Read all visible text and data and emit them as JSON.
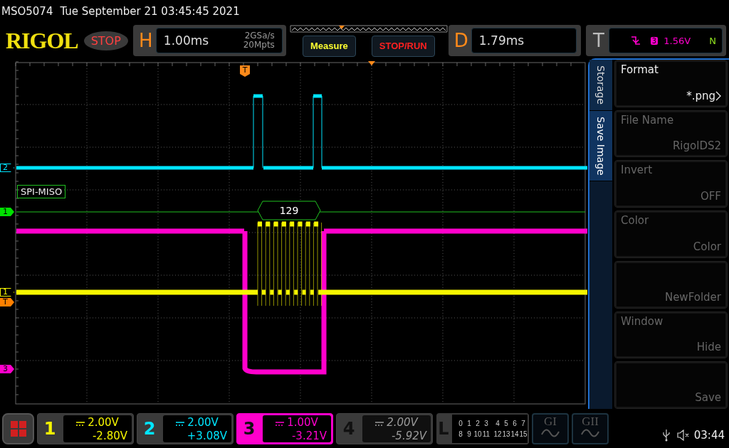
{
  "header": {
    "model": "MSO5074",
    "datetime": "Tue September 21 03:45:45 2021"
  },
  "topbar": {
    "logo": "RIGOL",
    "run_state": "STOP",
    "horizontal": {
      "letter": "H",
      "timebase": "1.00ms",
      "sample_rate": "2GSa/s",
      "memory_depth": "20Mpts"
    },
    "buttons": [
      {
        "label": "Measure",
        "kind": "measure"
      },
      {
        "label": "STOP/RUN",
        "kind": "run"
      }
    ],
    "delay": {
      "letter": "D",
      "value": "1.79ms"
    },
    "trigger": {
      "letter": "T",
      "source": "3",
      "level": "1.56V",
      "sweep": "N"
    }
  },
  "display": {
    "trigger_position_marker": "T",
    "markers": [
      {
        "label": "2",
        "color": "#00e5ff",
        "filled": false
      },
      {
        "label": "1",
        "color": "#00e000",
        "filled": true
      },
      {
        "label": "1",
        "color": "#f5f500",
        "filled": false
      },
      {
        "label": "T",
        "color": "#ff8000",
        "filled": true
      },
      {
        "label": "3",
        "color": "#ff00cc",
        "filled": true
      }
    ],
    "decode": {
      "label": "SPI-MISO",
      "value": "129"
    }
  },
  "side_menu": {
    "tabs": [
      {
        "label": "Storage",
        "selected": false
      },
      {
        "label": "Save Image",
        "selected": true
      }
    ],
    "items": [
      {
        "title": "Format",
        "value": "*.png",
        "submenu": true,
        "disabled": false
      },
      {
        "title": "File Name",
        "value": "RigolDS2",
        "submenu": false,
        "disabled": true
      },
      {
        "title": "Invert",
        "value": "OFF",
        "submenu": false,
        "disabled": true
      },
      {
        "title": "Color",
        "value": "Color",
        "submenu": false,
        "disabled": true
      },
      {
        "value": "NewFolder",
        "submenu": false,
        "disabled": true
      },
      {
        "title": "Window",
        "value": "Hide",
        "submenu": false,
        "disabled": true
      },
      {
        "value": "Save",
        "submenu": false,
        "disabled": true
      }
    ]
  },
  "channels": [
    {
      "number": "1",
      "scale": "2.00V",
      "offset": "-2.80V",
      "color": "#f5f500",
      "on": true,
      "selected": false
    },
    {
      "number": "2",
      "scale": "2.00V",
      "offset": "+3.08V",
      "color": "#00e5ff",
      "on": true,
      "selected": false
    },
    {
      "number": "3",
      "scale": "1.00V",
      "offset": "-3.21V",
      "color": "#ff00cc",
      "on": true,
      "selected": true
    },
    {
      "number": "4",
      "scale": "2.00V",
      "offset": "-5.92V",
      "color": "#9a9a9a",
      "on": false,
      "selected": false
    }
  ],
  "logic": {
    "letter": "L",
    "bits": [
      "0",
      "1",
      "2",
      "3",
      "4",
      "5",
      "6",
      "7",
      "8",
      "9",
      "10",
      "11",
      "12",
      "13",
      "14",
      "15"
    ]
  },
  "generators": [
    {
      "label": "GI"
    },
    {
      "label": "GII"
    }
  ],
  "status": {
    "time": "03:44"
  }
}
